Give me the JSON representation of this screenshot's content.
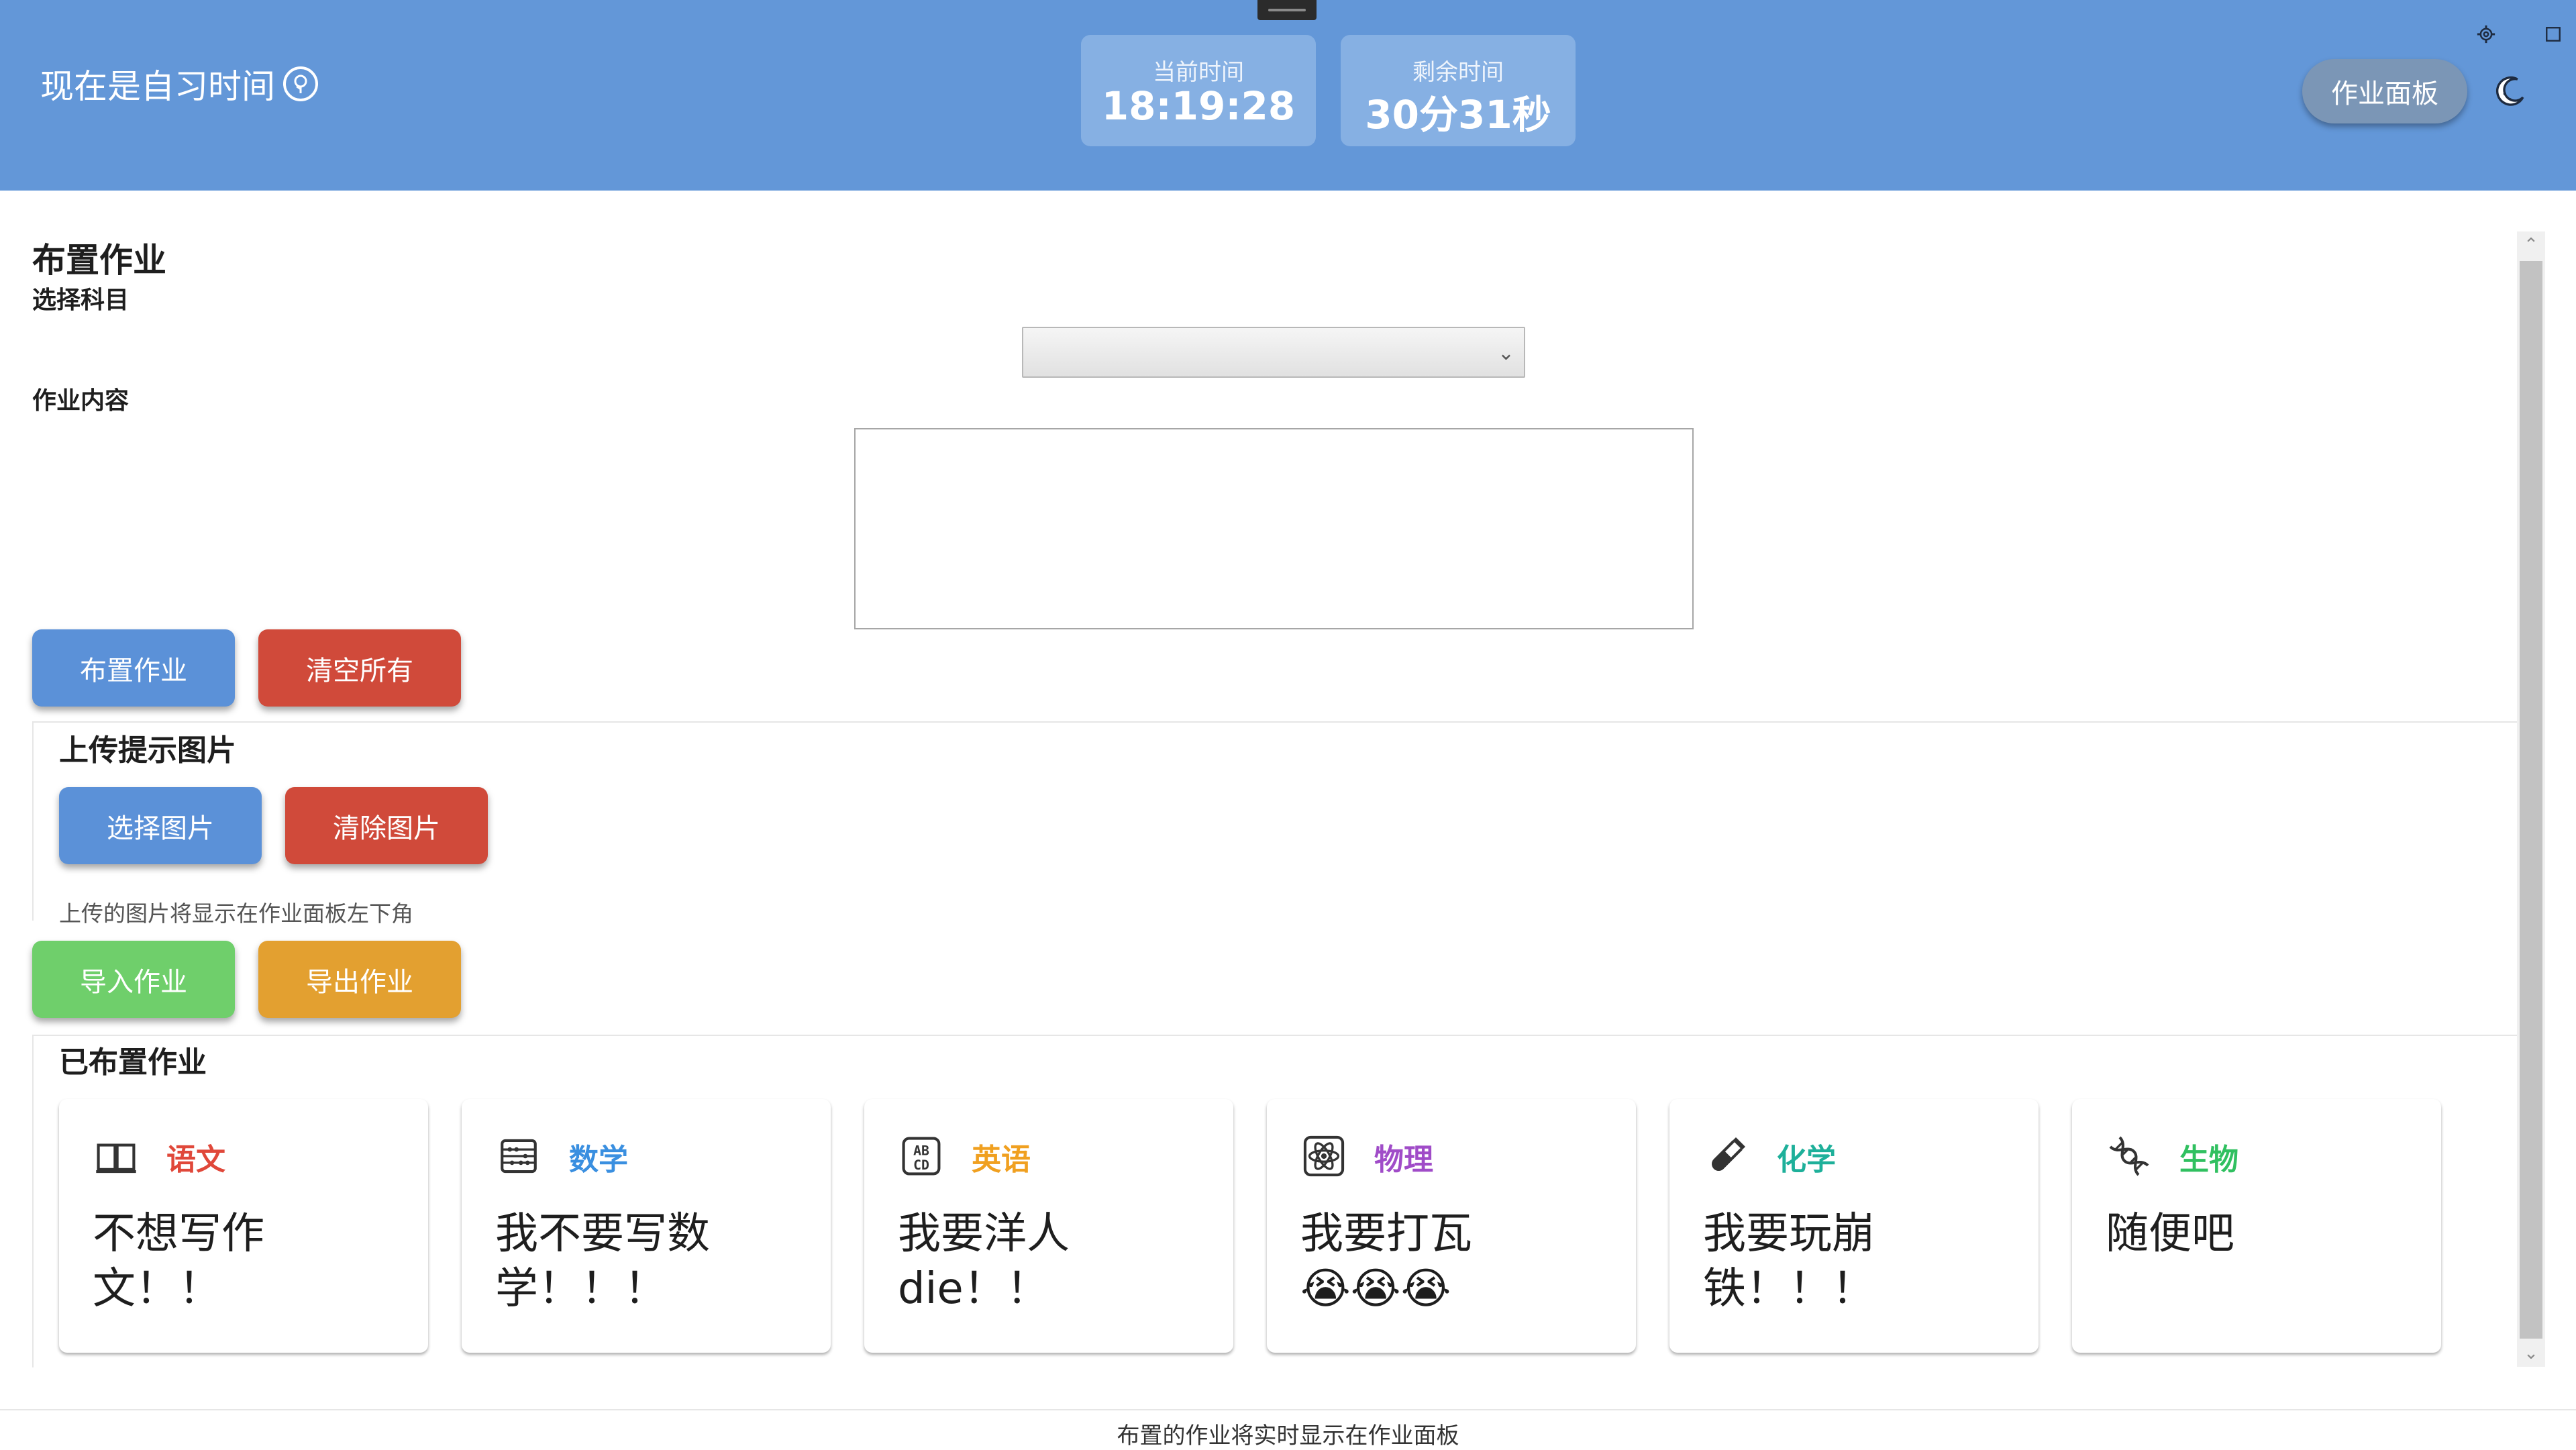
{
  "header": {
    "title": "现在是自习时间",
    "current_time": {
      "label": "当前时间",
      "value": "18:19:28"
    },
    "remaining_time": {
      "label": "剩余时间",
      "value": "30分31秒"
    },
    "panel_button": "作业面板",
    "icons": [
      "tree-icon",
      "settings-icon",
      "maximize-icon",
      "moon-icon"
    ]
  },
  "assign": {
    "title": "布置作业",
    "subject_label": "选择科目",
    "subject_value": "",
    "content_label": "作业内容",
    "content_value": "",
    "assign_button": "布置作业",
    "clear_all_button": "清空所有"
  },
  "upload": {
    "title": "上传提示图片",
    "choose_button": "选择图片",
    "clear_button": "清除图片",
    "hint": "上传的图片将显示在作业面板左下角"
  },
  "io": {
    "import_button": "导入作业",
    "export_button": "导出作业"
  },
  "assigned": {
    "title": "已布置作业",
    "cards": [
      {
        "subject": "语文",
        "content": "不想写作文！！",
        "color": "#e0483a",
        "icon": "book-icon"
      },
      {
        "subject": "数学",
        "content": "我不要写数学！！！",
        "color": "#3a8fe0",
        "icon": "abacus-icon"
      },
      {
        "subject": "英语",
        "content": "我要洋人die！！",
        "color": "#f0a020",
        "icon": "abcd-icon"
      },
      {
        "subject": "物理",
        "content": "我要打瓦",
        "emojis": "😭😭😭",
        "color": "#a04cc8",
        "icon": "atom-icon"
      },
      {
        "subject": "化学",
        "content": "我要玩崩铁！！！",
        "color": "#1eb09a",
        "icon": "test-tube-icon"
      },
      {
        "subject": "生物",
        "content": "随便吧",
        "color": "#30c060",
        "icon": "dna-icon"
      }
    ]
  },
  "footer": {
    "text": "布置的作业将实时显示在作业面板"
  }
}
